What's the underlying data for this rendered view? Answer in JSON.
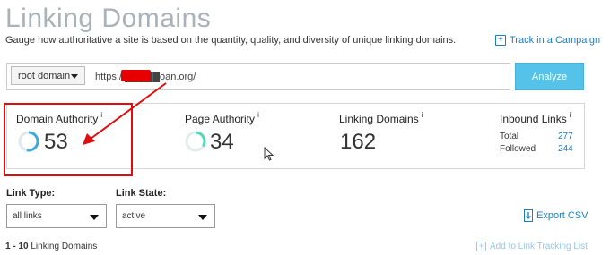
{
  "header": {
    "title": "Linking Domains",
    "subtitle": "Gauge how authoritative a site is based on the quantity, quality, and diversity of unique linking domains.",
    "track_label": "Track in a Campaign"
  },
  "search": {
    "scope_selected": "root domain",
    "url_value": "https://█████oan.org/",
    "analyze_label": "Analyze"
  },
  "metrics": {
    "domain_authority": {
      "label": "Domain Authority",
      "info": "i",
      "value": "53",
      "ring_fraction": 0.53,
      "ring_color": "#3fa9d9"
    },
    "page_authority": {
      "label": "Page Authority",
      "info": "i",
      "value": "34",
      "ring_fraction": 0.34,
      "ring_color": "#54d6b8"
    },
    "linking_domains": {
      "label": "Linking Domains",
      "info": "i",
      "value": "162"
    },
    "inbound_links": {
      "label": "Inbound Links",
      "info": "i",
      "total_label": "Total",
      "total_value": "277",
      "followed_label": "Followed",
      "followed_value": "244"
    }
  },
  "filters": {
    "link_type_label": "Link Type:",
    "link_type_selected": "all links",
    "link_state_label": "Link State:",
    "link_state_selected": "active",
    "export_label": "Export CSV"
  },
  "results": {
    "range": "1 - 10",
    "label": "Linking Domains",
    "add_tracking_label": "Add to Link Tracking List"
  },
  "colors": {
    "accent": "#1b7ec4",
    "analyze": "#55c2ea",
    "annotation": "#e10c0c"
  }
}
